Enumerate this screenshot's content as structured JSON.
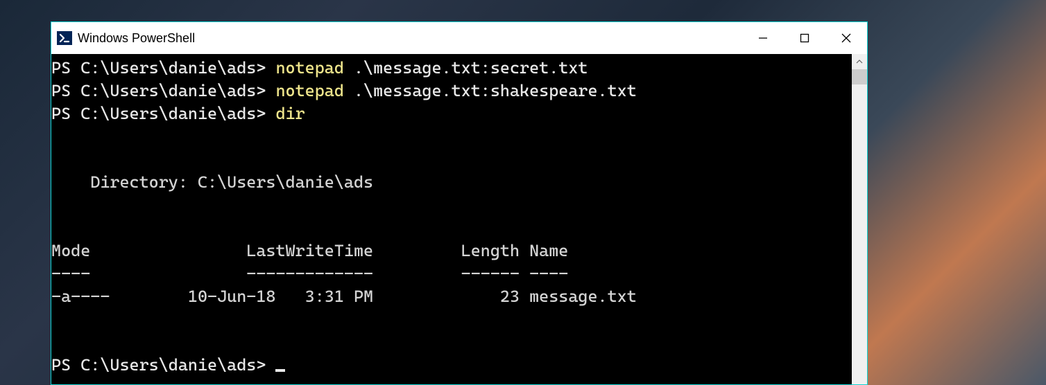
{
  "window": {
    "title": "Windows PowerShell"
  },
  "terminal": {
    "lines": [
      {
        "prompt": "PS C:\\Users\\danie\\ads> ",
        "cmd": "notepad",
        "arg": " .\\message.txt:secret.txt"
      },
      {
        "prompt": "PS C:\\Users\\danie\\ads> ",
        "cmd": "notepad",
        "arg": " .\\message.txt:shakespeare.txt"
      },
      {
        "prompt": "PS C:\\Users\\danie\\ads> ",
        "cmd": "dir",
        "arg": ""
      }
    ],
    "blank1": "",
    "blank2": "",
    "dir_header": "    Directory: C:\\Users\\danie\\ads",
    "blank3": "",
    "blank4": "",
    "col_header": "Mode                LastWriteTime         Length Name",
    "col_sep": "----                -------------         ------ ----",
    "row": "-a----        10-Jun-18   3:31 PM             23 message.txt",
    "blank5": "",
    "blank6": "",
    "final_prompt": "PS C:\\Users\\danie\\ads> "
  }
}
